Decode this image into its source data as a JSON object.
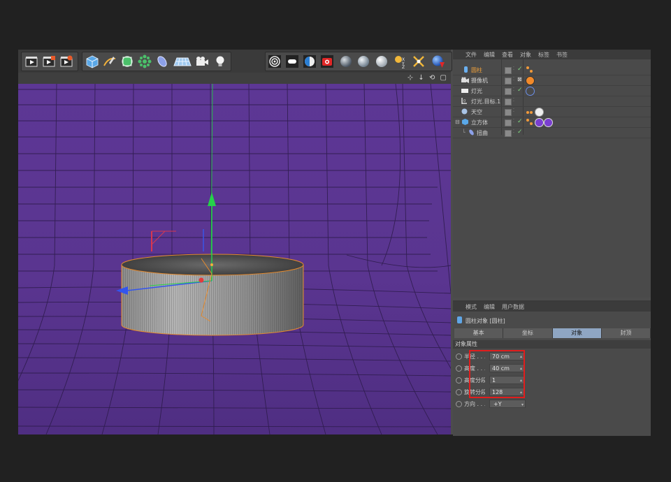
{
  "colors": {
    "accent_highlight": "#e11d1d",
    "selected_item": "#f2a23a",
    "viewport_background": "#5a3590",
    "active_tab": "#8fa6c3",
    "axis_y": "#22cc33",
    "axis_x": "#e23b3b",
    "axis_z": "#3355ee"
  },
  "toolbar": {
    "left_icons": [
      "render-view-icon",
      "render-to-picture-viewer-icon",
      "render-settings-icon"
    ],
    "object_icons": [
      "cube-icon",
      "pen-spline-icon",
      "subdivision-icon",
      "array-icon",
      "deformer-icon",
      "floor-grid-icon",
      "camera-icon",
      "light-bulb-icon"
    ],
    "render_icons": [
      "target-circle-icon",
      "lamp-rect-icon",
      "contrast-circle-icon",
      "record-camera-icon",
      "sphere-dark-icon",
      "sphere-glass-icon",
      "sphere-white-icon",
      "xyz-axis-icon",
      "snap-cross-icon",
      "world-globe-icon"
    ]
  },
  "viewport_nav": {
    "icons": "⊹ ↓ ⟲ ▢"
  },
  "object_manager": {
    "menu": [
      "文件",
      "编辑",
      "查看",
      "对象",
      "标签",
      "书签"
    ],
    "items": [
      {
        "name": "圆柱",
        "icon": "cylinder-icon",
        "selected": true
      },
      {
        "name": "摄像机",
        "icon": "camera-icon",
        "selected": false
      },
      {
        "name": "灯光",
        "icon": "light-icon",
        "selected": false
      },
      {
        "name": "灯光.目标.1",
        "icon": "light-target-icon",
        "selected": false
      },
      {
        "name": "天空",
        "icon": "sky-icon",
        "selected": false
      },
      {
        "name": "立方体",
        "icon": "cube-icon",
        "selected": false
      },
      {
        "name": "扭曲",
        "icon": "bend-icon",
        "selected": false
      }
    ]
  },
  "attribute_manager": {
    "menu": [
      "模式",
      "编辑",
      "用户数据"
    ],
    "title": "圆柱对象 [圆柱]",
    "tabs": [
      {
        "label": "基本",
        "active": false
      },
      {
        "label": "坐标",
        "active": false
      },
      {
        "label": "对象",
        "active": true
      },
      {
        "label": "封顶",
        "active": false
      }
    ],
    "section": "对象属性",
    "fields": [
      {
        "label": "半径 . . . .",
        "value": "70 cm"
      },
      {
        "label": "高度 . . . .",
        "value": "40 cm"
      },
      {
        "label": "高度分段",
        "value": "1"
      },
      {
        "label": "旋转分段",
        "value": "128"
      }
    ],
    "orientation": {
      "label": "方向 . . . .",
      "value": "+Y"
    }
  }
}
